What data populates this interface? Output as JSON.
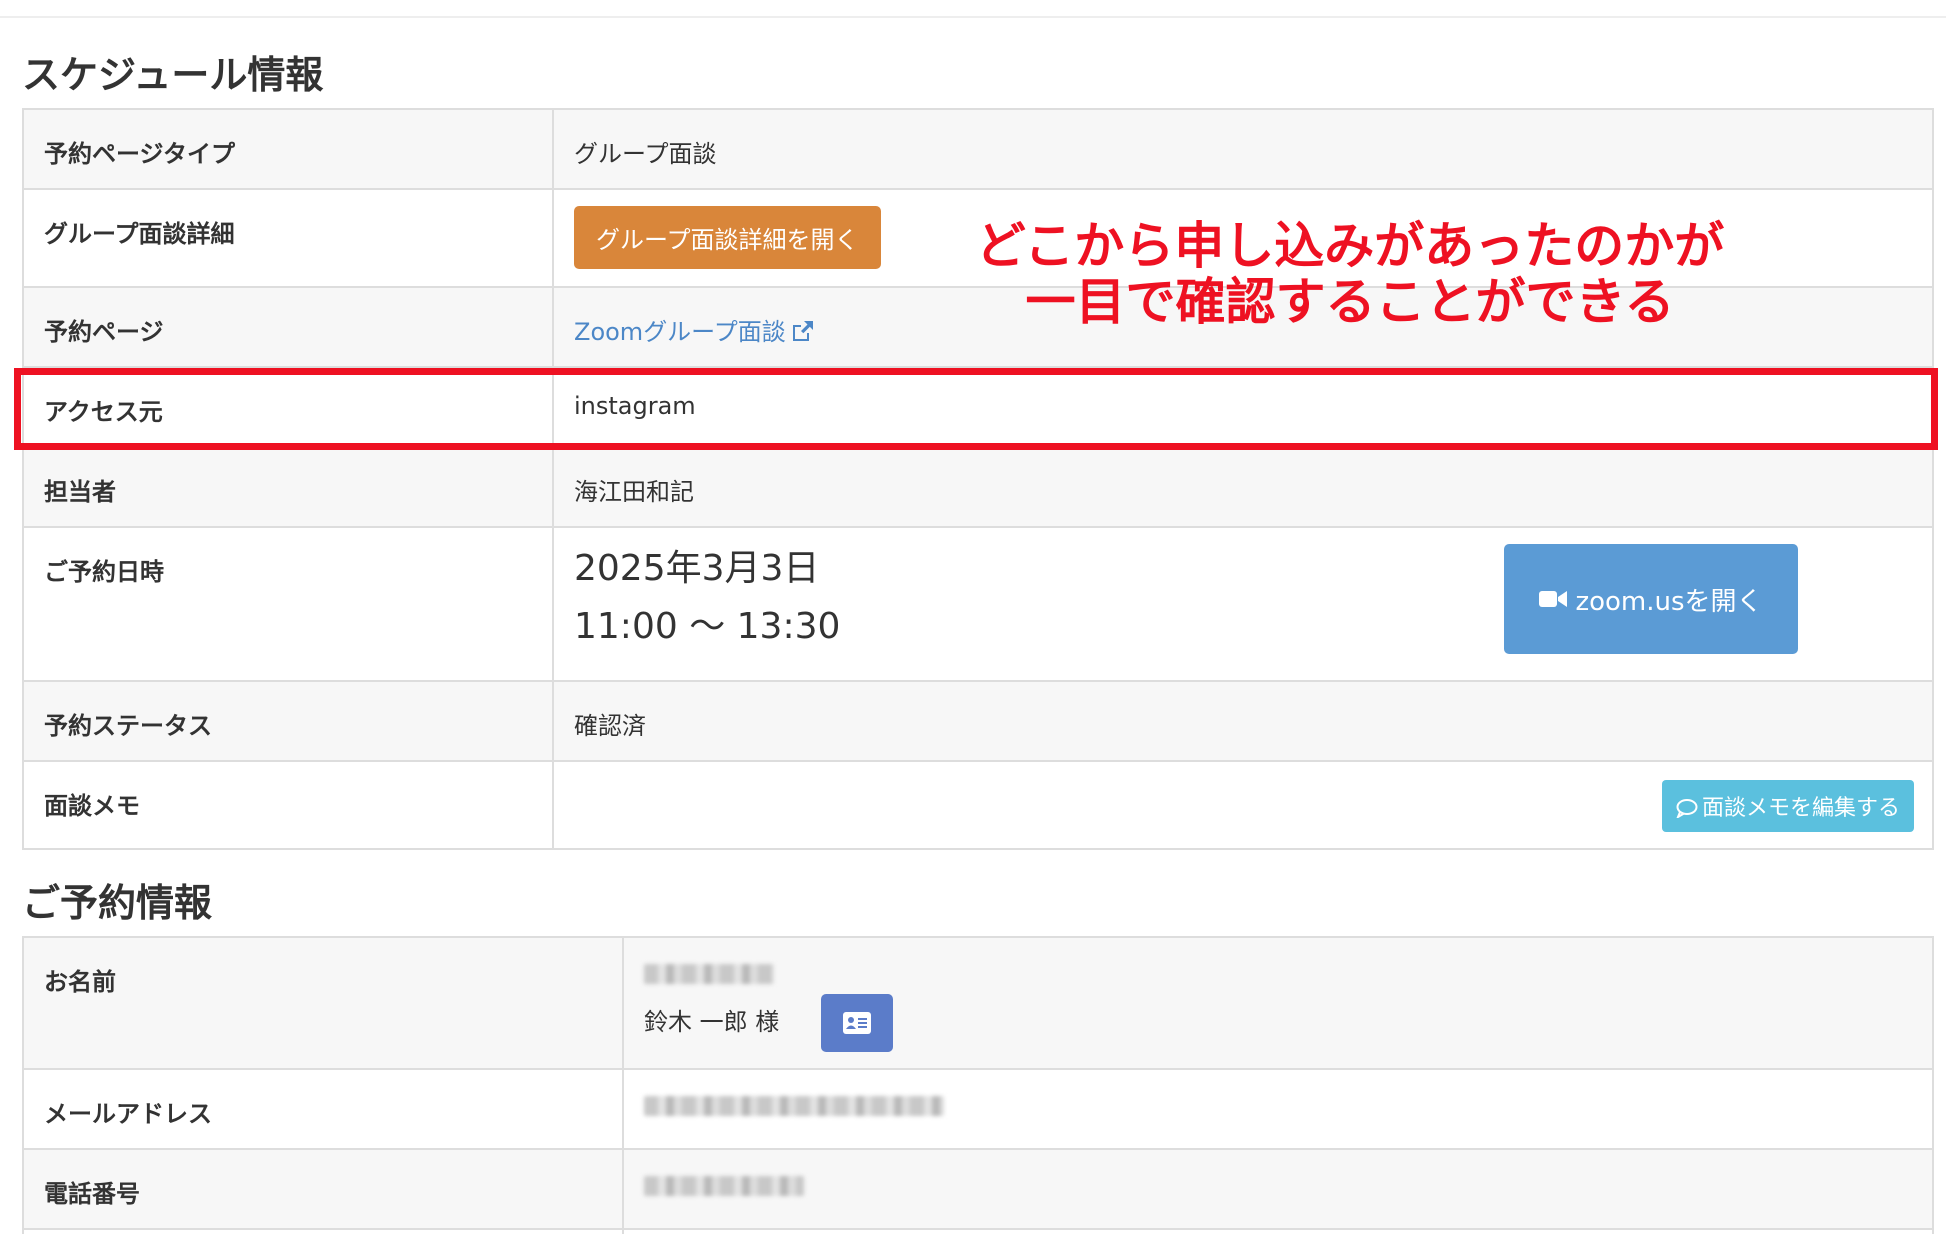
{
  "schedule": {
    "title": "スケジュール情報",
    "rows": {
      "page_type": {
        "label": "予約ページタイプ",
        "value": "グループ面談"
      },
      "group_detail": {
        "label": "グループ面談詳細",
        "button": "グループ面談詳細を開く"
      },
      "reserve_page": {
        "label": "予約ページ",
        "link": "Zoomグループ面談"
      },
      "access": {
        "label": "アクセス元",
        "value": "instagram"
      },
      "staff": {
        "label": "担当者",
        "value": "海江田和記"
      },
      "datetime": {
        "label": "ご予約日時",
        "date": "2025年3月3日",
        "time": "11:00 〜 13:30",
        "zoom_button": "zoom.usを開く"
      },
      "status": {
        "label": "予約ステータス",
        "value": "確認済"
      },
      "memo": {
        "label": "面談メモ",
        "button": "面談メモを編集する"
      }
    }
  },
  "reservation": {
    "title": "ご予約情報",
    "rows": {
      "name": {
        "label": "お名前",
        "value": "鈴木 一郎 様"
      },
      "email": {
        "label": "メールアドレス"
      },
      "phone": {
        "label": "電話番号"
      }
    }
  },
  "annotation": {
    "line1": "どこから申し込みがあったのかが",
    "line2": "一目で確認することができる"
  },
  "colors": {
    "highlight": "#ee1122",
    "orange_button": "#d9863a",
    "zoom_button": "#5b9bd5",
    "memo_button": "#5bc0de",
    "link": "#4c87c7"
  },
  "icons": {
    "external_link": "external-link-icon",
    "video": "video-camera-icon",
    "comment": "comment-icon",
    "card": "contact-card-icon"
  }
}
